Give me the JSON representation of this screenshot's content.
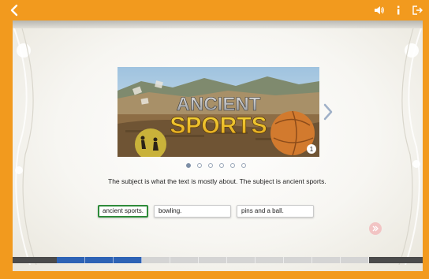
{
  "icons": {
    "back": "chevron-left-icon",
    "audio": "speaker-icon",
    "info": "info-icon",
    "exit": "exit-icon",
    "next": "chevron-right-icon",
    "play_audio": "double-arrow-icon"
  },
  "colors": {
    "frame": "#f29a1e",
    "selected_border": "#2e8b3a",
    "progress_done": "#2e63b5"
  },
  "hero": {
    "title_line1": "ANCIENT",
    "title_line2": "SPORTS",
    "page_badge": "1"
  },
  "pager": {
    "count": 6,
    "active_index": 0
  },
  "passage": {
    "text": "The subject is what the text is mostly about. The subject is ancient sports."
  },
  "choices": [
    {
      "label": "ancient sports.",
      "selected": true
    },
    {
      "label": "bowling.",
      "selected": false
    },
    {
      "label": "pins and a ball.",
      "selected": false
    }
  ],
  "progress": {
    "total_segments": 11,
    "completed_segments": 3
  }
}
